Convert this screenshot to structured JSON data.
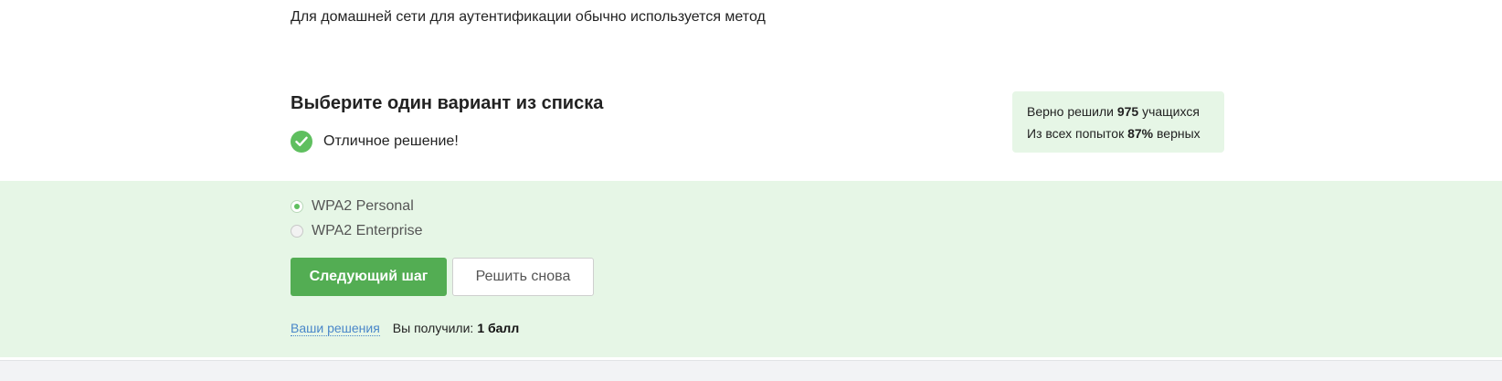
{
  "question": {
    "text": "Для домашней сети для аутентификации обычно используется метод"
  },
  "quiz": {
    "title": "Выберите один вариант из списка",
    "result_text": "Отличное решение!"
  },
  "stats": {
    "line1_prefix": "Верно решили",
    "line1_count": "975",
    "line1_suffix": "учащихся",
    "line2_prefix": "Из всех попыток",
    "line2_percent": "87%",
    "line2_suffix": "верных"
  },
  "options": [
    {
      "label": "WPA2 Personal",
      "selected": true
    },
    {
      "label": "WPA2 Enterprise",
      "selected": false
    }
  ],
  "actions": {
    "next_label": "Следующий шаг",
    "retry_label": "Решить снова"
  },
  "footer": {
    "solutions_link": "Ваши решения",
    "score_label": "Вы получили:",
    "score_value": "1 балл"
  },
  "colors": {
    "accent_green": "#53ad53",
    "panel_green": "#e6f6e6",
    "link_blue": "#4a87c9"
  },
  "icons": {
    "result": "check-circle-icon"
  }
}
